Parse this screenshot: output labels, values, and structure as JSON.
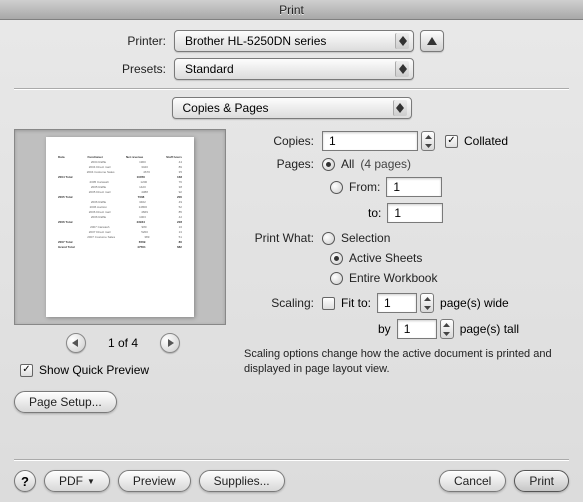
{
  "title": "Print",
  "labels": {
    "printer": "Printer:",
    "presets": "Presets:",
    "copies": "Copies:",
    "collated": "Collated",
    "pages": "Pages:",
    "all": "All",
    "all_count": "(4 pages)",
    "from": "From:",
    "to": "to:",
    "print_what": "Print What:",
    "selection": "Selection",
    "active_sheets": "Active Sheets",
    "entire_workbook": "Entire Workbook",
    "scaling": "Scaling:",
    "fit_to": "Fit to:",
    "pages_wide": "page(s) wide",
    "by": "by",
    "pages_tall": "page(s) tall",
    "show_quick_preview": "Show Quick Preview",
    "page_setup": "Page Setup...",
    "nav_status": "1 of 4",
    "hint": "Scaling options change how the active document is printed and displayed in page layout view."
  },
  "values": {
    "printer": "Brother HL-5250DN series",
    "preset": "Standard",
    "section": "Copies & Pages",
    "copies": "1",
    "from": "1",
    "to": "1",
    "fit_wide": "1",
    "fit_tall": "1"
  },
  "footer": {
    "pdf": "PDF",
    "preview": "Preview",
    "supplies": "Supplies...",
    "cancel": "Cancel",
    "print": "Print"
  }
}
